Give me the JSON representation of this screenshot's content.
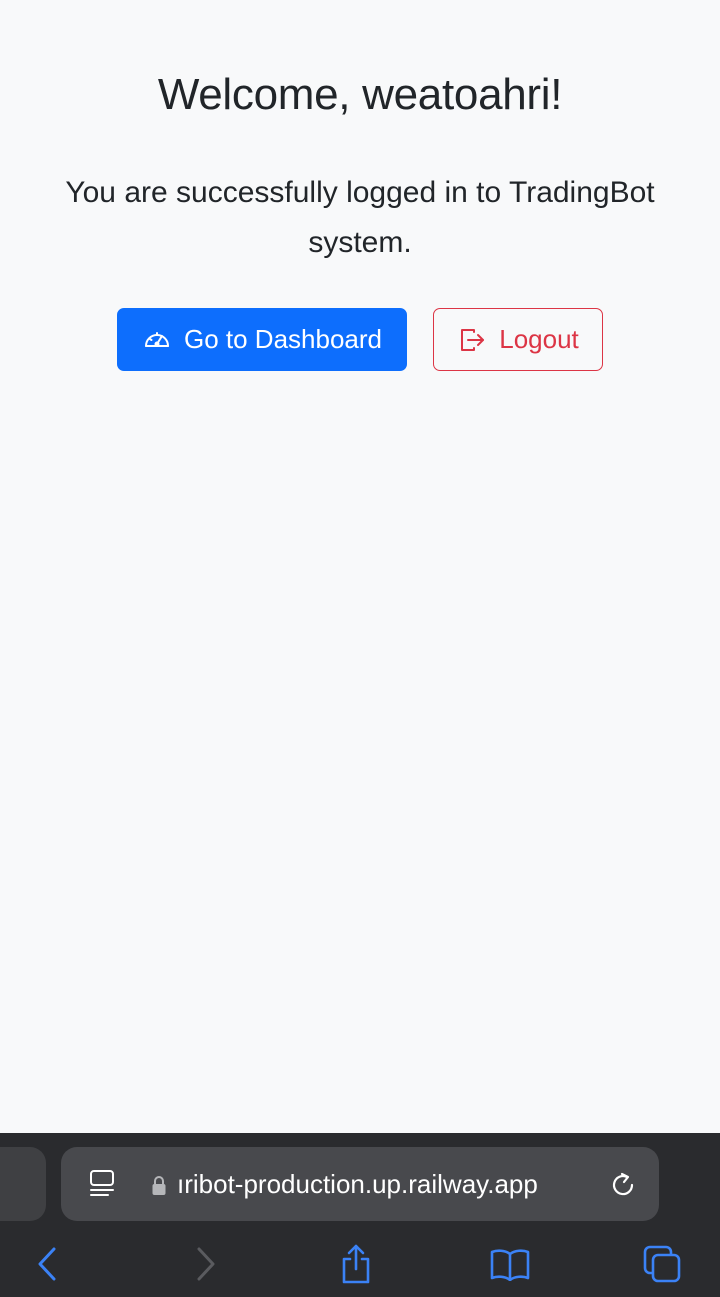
{
  "page": {
    "title": "Welcome, weatoahri!",
    "message": "You are successfully logged in to TradingBot system."
  },
  "buttons": {
    "dashboard_label": "Go to Dashboard",
    "logout_label": "Logout"
  },
  "browser": {
    "url": "ıribot-production.up.railway.app"
  },
  "icons": {
    "dashboard": "speedometer-icon",
    "logout": "logout-icon",
    "reader": "reader-mode-icon",
    "lock": "lock-icon",
    "reload": "reload-icon",
    "back": "back-chevron-icon",
    "forward": "forward-chevron-icon",
    "share": "share-icon",
    "bookmarks": "bookmarks-icon",
    "tabs": "tabs-icon"
  },
  "colors": {
    "primary": "#0d6efd",
    "danger": "#dc3545",
    "background": "#f8f9fa",
    "safari_bar": "#2a2b2e",
    "safari_accent": "#3b82f6"
  }
}
